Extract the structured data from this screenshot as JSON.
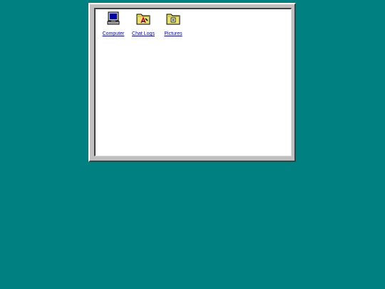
{
  "desktop": {
    "background": "#008080"
  },
  "window": {
    "items": [
      {
        "label": "Computer",
        "icon": "computer-icon"
      },
      {
        "label": "Chat Logs",
        "icon": "chat-logs-folder-icon"
      },
      {
        "label": "Pictures",
        "icon": "pictures-folder-icon"
      }
    ]
  }
}
